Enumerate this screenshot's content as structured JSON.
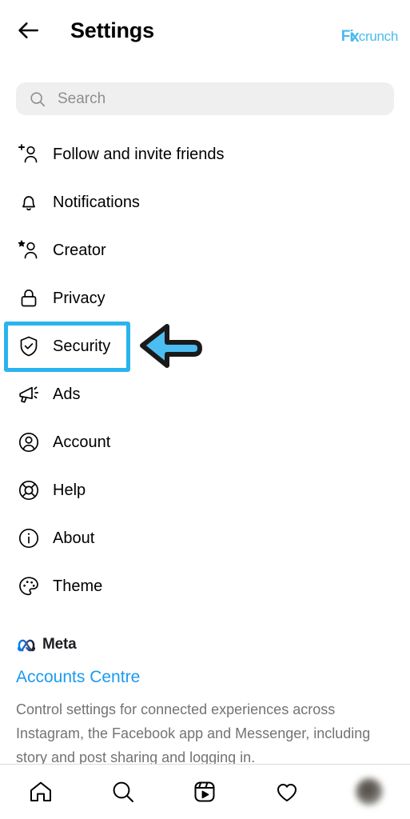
{
  "header": {
    "back_icon": "arrow-left-icon",
    "title": "Settings",
    "brand": {
      "part1": "Fi",
      "part2": "x",
      "part3": "crunch",
      "color": "#49baf0"
    }
  },
  "search": {
    "icon": "search-icon",
    "placeholder": "Search",
    "value": ""
  },
  "menu": {
    "items": [
      {
        "label": "Follow and invite friends",
        "icon": "person-add-icon"
      },
      {
        "label": "Notifications",
        "icon": "bell-icon"
      },
      {
        "label": "Creator",
        "icon": "person-star-icon"
      },
      {
        "label": "Privacy",
        "icon": "lock-icon"
      },
      {
        "label": "Security",
        "icon": "shield-check-icon"
      },
      {
        "label": "Ads",
        "icon": "megaphone-icon"
      },
      {
        "label": "Account",
        "icon": "person-circle-icon"
      },
      {
        "label": "Help",
        "icon": "lifebuoy-icon"
      },
      {
        "label": "About",
        "icon": "info-circle-icon"
      },
      {
        "label": "Theme",
        "icon": "palette-icon"
      }
    ]
  },
  "annotation": {
    "highlighted_item": "Security",
    "highlight_color": "#29b3ef",
    "arrow_icon": "arrow-left-pointer-icon",
    "arrow_color": "#4cbdf0"
  },
  "meta_section": {
    "logo_icon": "meta-infinity-icon",
    "brand": "Meta",
    "link": "Accounts Centre",
    "link_color": "#1a9bf0",
    "description": "Control settings for connected experiences across Instagram, the Facebook app and Messenger, including story and post sharing and logging in."
  },
  "bottom_nav": {
    "items": [
      {
        "name": "home",
        "icon": "home-icon"
      },
      {
        "name": "search",
        "icon": "search-icon"
      },
      {
        "name": "reels",
        "icon": "reels-icon"
      },
      {
        "name": "activity",
        "icon": "heart-icon"
      },
      {
        "name": "profile",
        "icon": "avatar-icon"
      }
    ]
  }
}
